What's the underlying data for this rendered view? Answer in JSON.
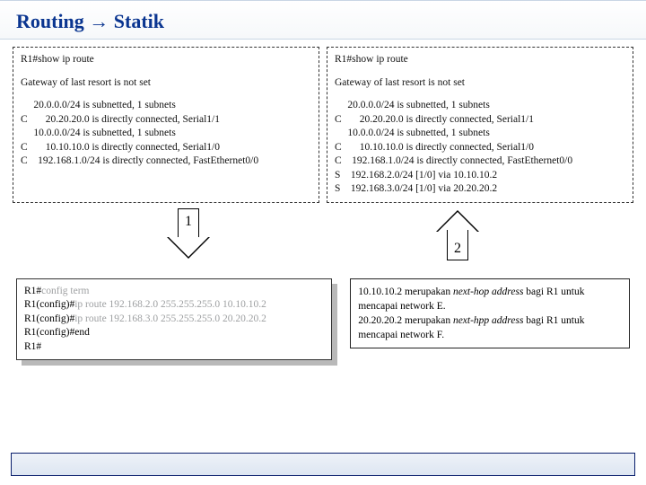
{
  "header": {
    "title": "Routing → Statik"
  },
  "panelLeft": {
    "cmd": "R1#show ip route",
    "gateway": "Gateway of last resort is not set",
    "lines": [
      "     20.0.0.0/24 is subnetted, 1 subnets",
      "C       20.20.20.0 is directly connected, Serial1/1",
      "     10.0.0.0/24 is subnetted, 1 subnets",
      "C       10.10.10.0 is directly connected, Serial1/0",
      "C    192.168.1.0/24 is directly connected, FastEthernet0/0"
    ]
  },
  "panelRight": {
    "cmd": "R1#show ip route",
    "gateway": "Gateway of last resort is not set",
    "lines": [
      "     20.0.0.0/24 is subnetted, 1 subnets",
      "C       20.20.20.0 is directly connected, Serial1/1",
      "     10.0.0.0/24 is subnetted, 1 subnets",
      "C       10.10.10.0 is directly connected, Serial1/0",
      "C    192.168.1.0/24 is directly connected, FastEthernet0/0",
      "S    192.168.2.0/24 [1/0] via 10.10.10.2",
      "S    192.168.3.0/24 [1/0] via 20.20.20.2"
    ]
  },
  "arrows": {
    "one": "1",
    "two": "2"
  },
  "config": {
    "l1a": "R1#",
    "l1b": "config term",
    "l2a": "R1(config)#",
    "l2b": "ip route 192.168.2.0 255.255.255.0 10.10.10.2",
    "l3a": "R1(config)#",
    "l3b": "ip route 192.168.3.0 255.255.255.0 20.20.20.2",
    "l4": "R1(config)#end",
    "l5": "R1#"
  },
  "note": {
    "p1a": "10.10.10.2 merupakan ",
    "p1b": "next-hop address",
    "p1c": " bagi R1 untuk mencapai network E.",
    "p2a": "20.20.20.2 merupakan ",
    "p2b": "next-hpp address",
    "p2c": " bagi R1 untuk mencapai network F."
  }
}
